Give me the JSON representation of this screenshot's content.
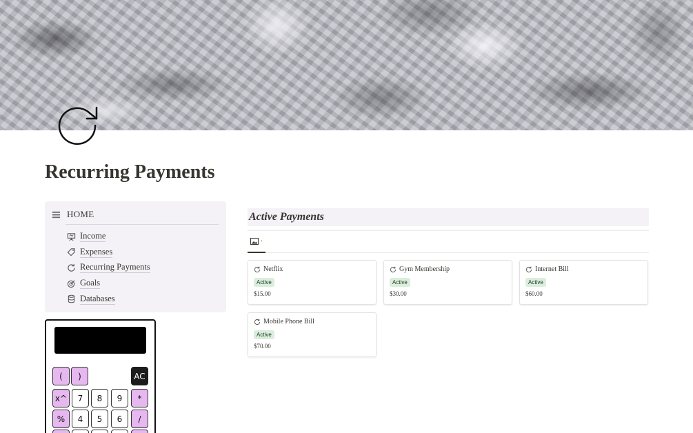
{
  "page": {
    "title": "Recurring Payments"
  },
  "nav": {
    "home_label": "HOME",
    "items": [
      {
        "label": "Income",
        "icon": "presentation-icon"
      },
      {
        "label": "Expenses",
        "icon": "tag-icon"
      },
      {
        "label": "Recurring Payments",
        "icon": "refresh-icon"
      },
      {
        "label": "Goals",
        "icon": "target-icon"
      },
      {
        "label": "Databases",
        "icon": "database-icon"
      }
    ]
  },
  "calculator": {
    "display": "",
    "keys": {
      "lparen": "(",
      "rparen": ")",
      "ac": "AC",
      "pow": "x^",
      "k7": "7",
      "k8": "8",
      "k9": "9",
      "mul": "*",
      "mod": "%",
      "k4": "4",
      "k5": "5",
      "k6": "6",
      "div": "/"
    }
  },
  "database": {
    "title": "Active Payments",
    "view_label": "·",
    "cards": [
      {
        "name": "Netflix",
        "status": "Active",
        "amount": "$15.00"
      },
      {
        "name": "Gym Membership",
        "status": "Active",
        "amount": "$30.00"
      },
      {
        "name": "Internet Bill",
        "status": "Active",
        "amount": "$60.00"
      },
      {
        "name": "Mobile Phone Bill",
        "status": "Active",
        "amount": "$70.00"
      }
    ]
  },
  "colors": {
    "text": "#37352f",
    "nav_bg": "#f4f2f7",
    "calc_operator": "#e7b8f0",
    "badge_bg": "#dbeddb",
    "badge_text": "#1c3829"
  }
}
